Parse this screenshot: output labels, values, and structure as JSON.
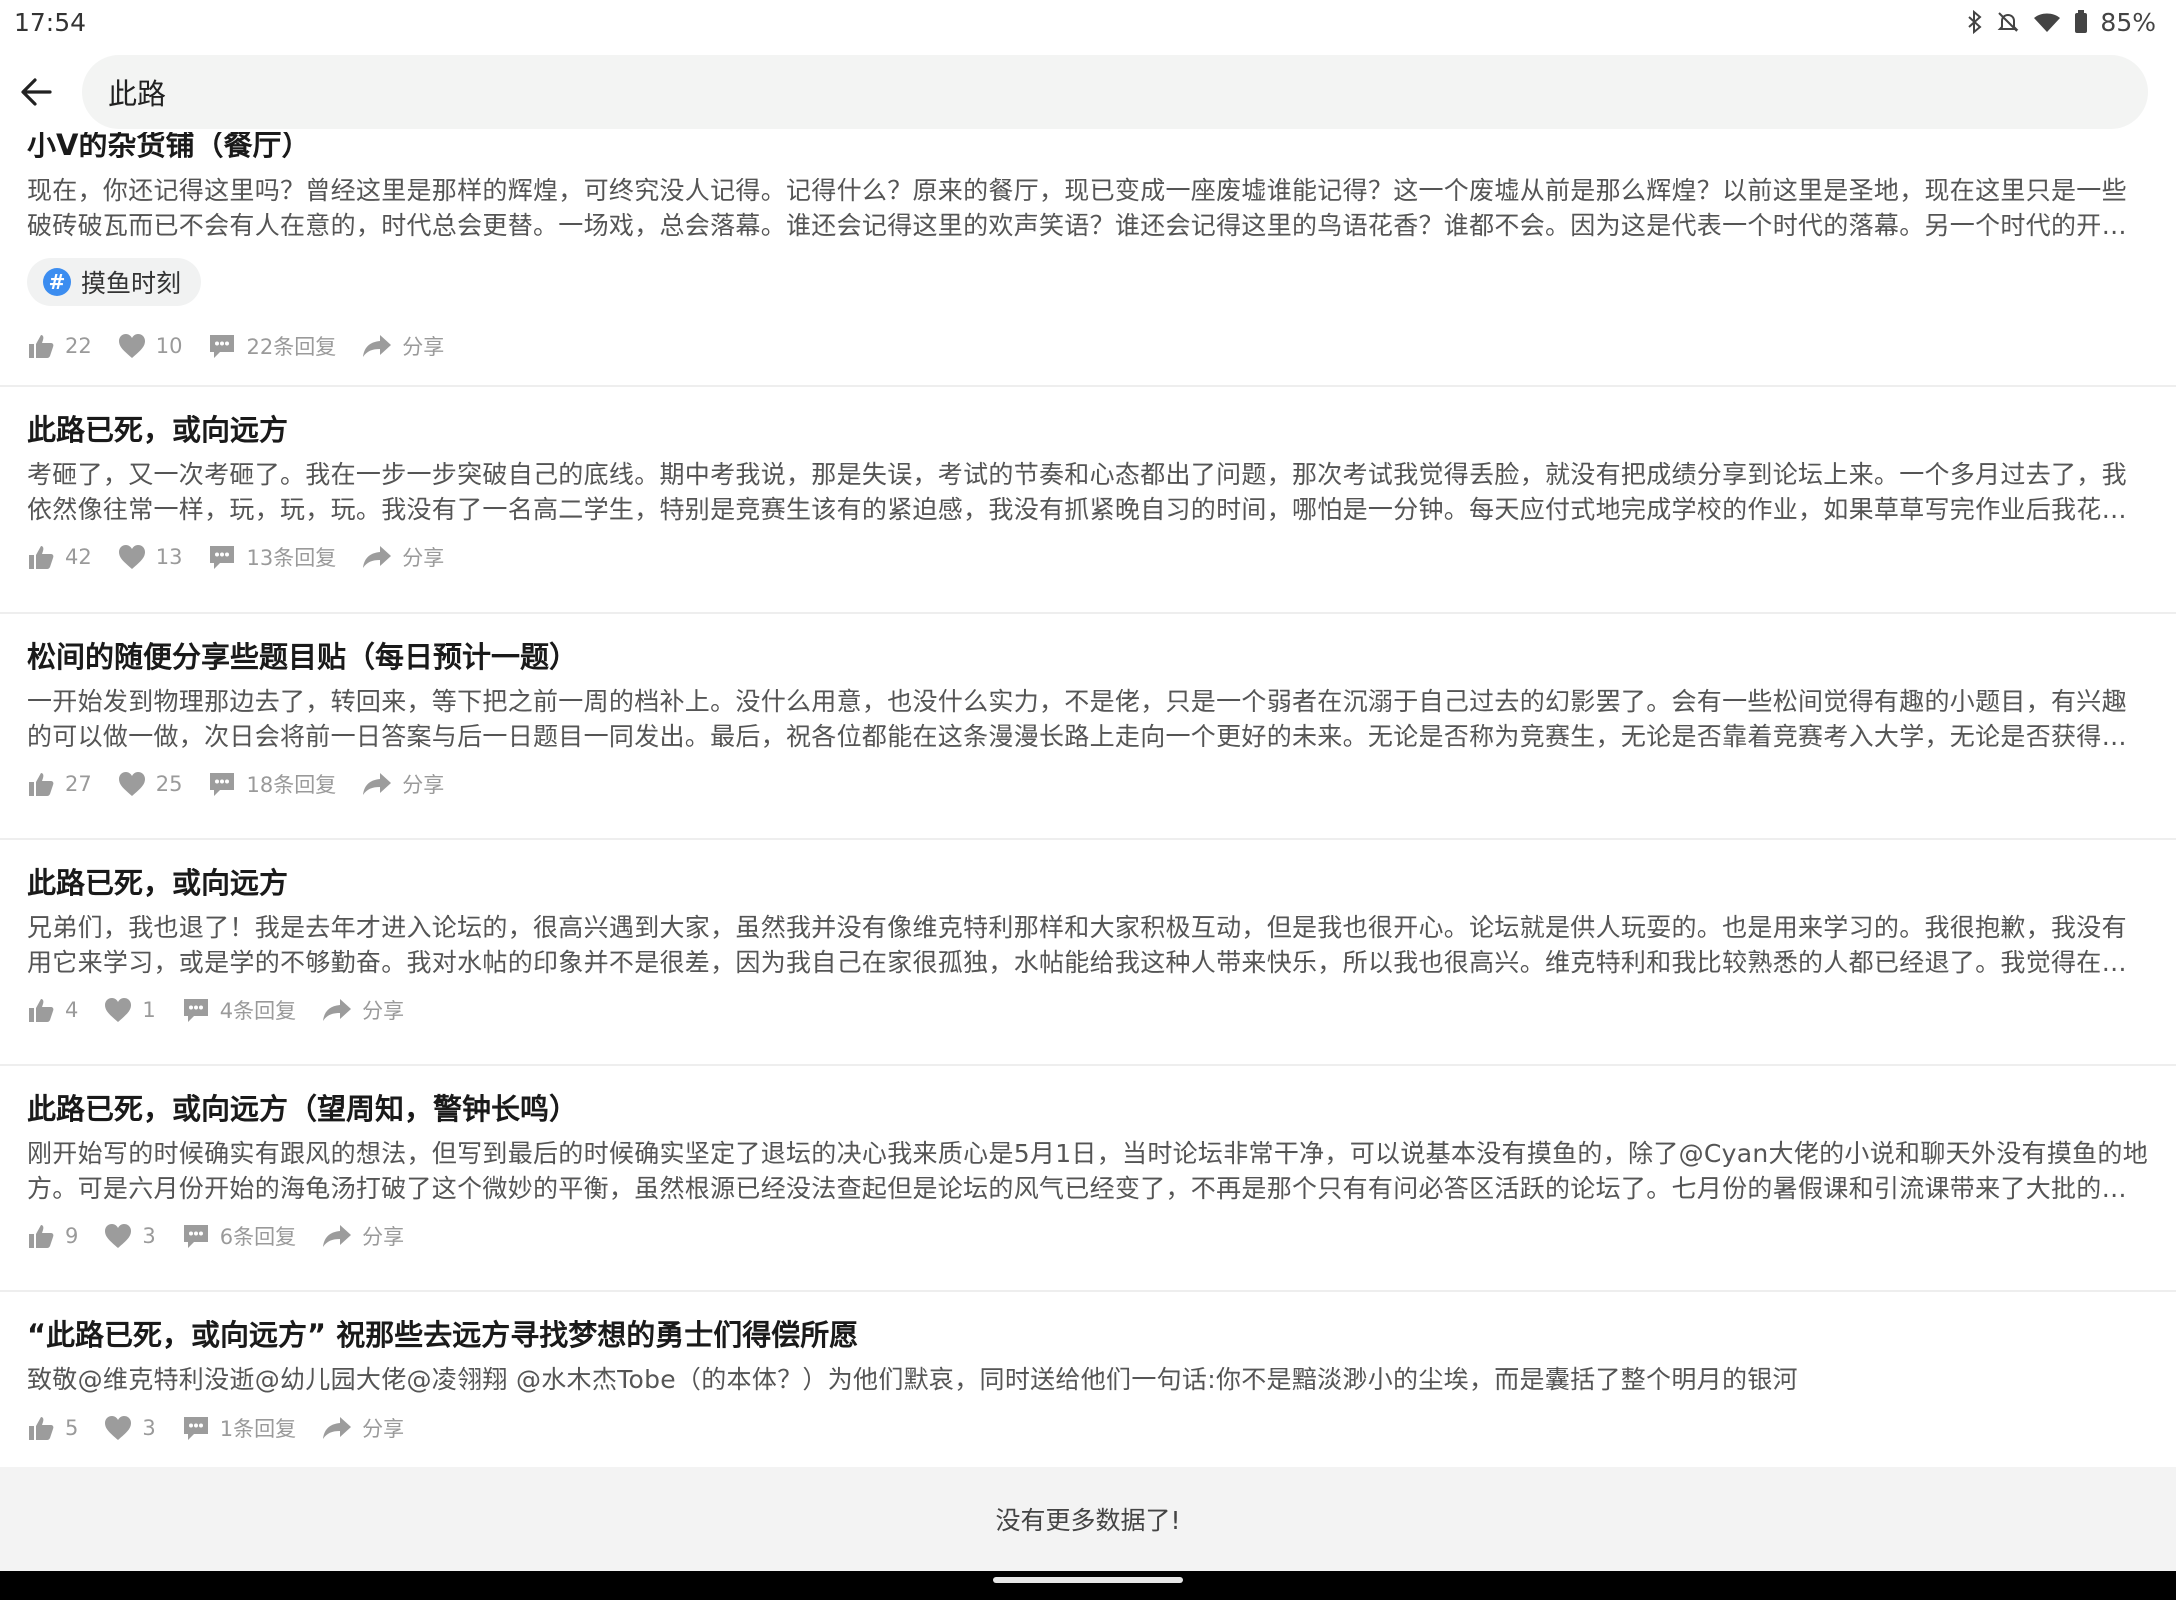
{
  "status_bar": {
    "time": "17:54",
    "battery": "85%",
    "icons": [
      "bluetooth-icon",
      "bell-off-icon",
      "wifi-icon",
      "battery-icon"
    ]
  },
  "search": {
    "query": "此路",
    "back_icon": "arrow-left-icon"
  },
  "posts": [
    {
      "title": "小V的杂货铺（餐厅）",
      "excerpt": "现在，你还记得这里吗？曾经这里是那样的辉煌，可终究没人记得。记得什么？原来的餐厅，现已变成一座废墟谁能记得？这一个废墟从前是那么辉煌？以前这里是圣地，现在这里只是一些破砖破瓦而已不会有人在意的，时代总会更替。一场戏，总会落幕。谁还会记得这里的欢声笑语？谁还会记得这里的鸟语花香？谁都不会。因为这是代表一个时代的落幕。另一个时代的开启。不必为尘埃而哭泣",
      "tag": "摸鱼时刻",
      "likes": "22",
      "hearts": "10",
      "replies": "22条回复",
      "share": "分享"
    },
    {
      "title": "此路已死，或向远方",
      "excerpt": "考砸了，又一次考砸了。我在一步一步突破自己的底线。期中考我说，那是失误，考试的节奏和心态都出了问题，那次考试我觉得丢脸，就没有把成绩分享到论坛上来。一个多月过去了，我依然像往常一样，玩，玩，玩。我没有了一名高二学生，特别是竞赛生该有的紧迫感，我没有抓紧晚自习的时间，哪怕是一分钟。每天应付式地完成学校的作业，如果草草写完作业后我花上两三个小时刷题",
      "likes": "42",
      "hearts": "13",
      "replies": "13条回复",
      "share": "分享"
    },
    {
      "title": "松间的随便分享些题目贴（每日预计一题）",
      "excerpt": "一开始发到物理那边去了，转回来，等下把之前一周的档补上。没什么用意，也没什么实力，不是佬，只是一个弱者在沉溺于自己过去的幻影罢了。会有一些松间觉得有趣的小题目，有兴趣的可以做一做，次日会将前一日答案与后一日题目一同发出。最后，祝各位都能在这条漫漫长路上走向一个更好的未来。无论是否称为竞赛生，无论是否靠着竞赛考入大学，无论是否获得自己心仪的奖项",
      "likes": "27",
      "hearts": "25",
      "replies": "18条回复",
      "share": "分享"
    },
    {
      "title": "此路已死，或向远方",
      "excerpt": "兄弟们，我也退了！我是去年才进入论坛的，很高兴遇到大家，虽然我并没有像维克特利那样和大家积极互动，但是我也很开心。论坛就是供人玩耍的。也是用来学习的。我很抱歉，我没有用它来学习，或是学的不够勤奋。我对水帖的印象并不是很差，因为我自己在家很孤独，水帖能给我这种人带来快乐，所以我也很高兴。维克特利和我比较熟悉的人都已经退了。我觉得在论坛上也没有什么意思了",
      "likes": "4",
      "hearts": "1",
      "replies": "4条回复",
      "share": "分享"
    },
    {
      "title": "此路已死，或向远方（望周知，警钟长鸣）",
      "excerpt": "刚开始写的时候确实有跟风的想法，但写到最后的时候确实坚定了退坛的决心我来质心是5月1日，当时论坛非常干净，可以说基本没有摸鱼的，除了@Cyan大佬的小说和聊天外没有摸鱼的地方。可是六月份开始的海龟汤打破了这个微妙的平衡，虽然根源已经没法查起但是论坛的风气已经变了，不再是那个只有有问必答区活跃的论坛了。七月份的暑假课和引流课带来了大批的学员，可是当时的论坛",
      "likes": "9",
      "hearts": "3",
      "replies": "6条回复",
      "share": "分享"
    },
    {
      "title": "“此路已死，或向远方”  祝那些去远方寻找梦想的勇士们得偿所愿",
      "excerpt": "致敬@维克特利没逝@幼儿园大佬@凌翎翔 @水木杰Tobe（的本体？）为他们默哀，同时送给他们一句话:你不是黯淡渺小的尘埃，而是囊括了整个明月的银河",
      "likes": "5",
      "hearts": "3",
      "replies": "1条回复",
      "share": "分享"
    }
  ],
  "footer": {
    "text": "没有更多数据了!"
  }
}
